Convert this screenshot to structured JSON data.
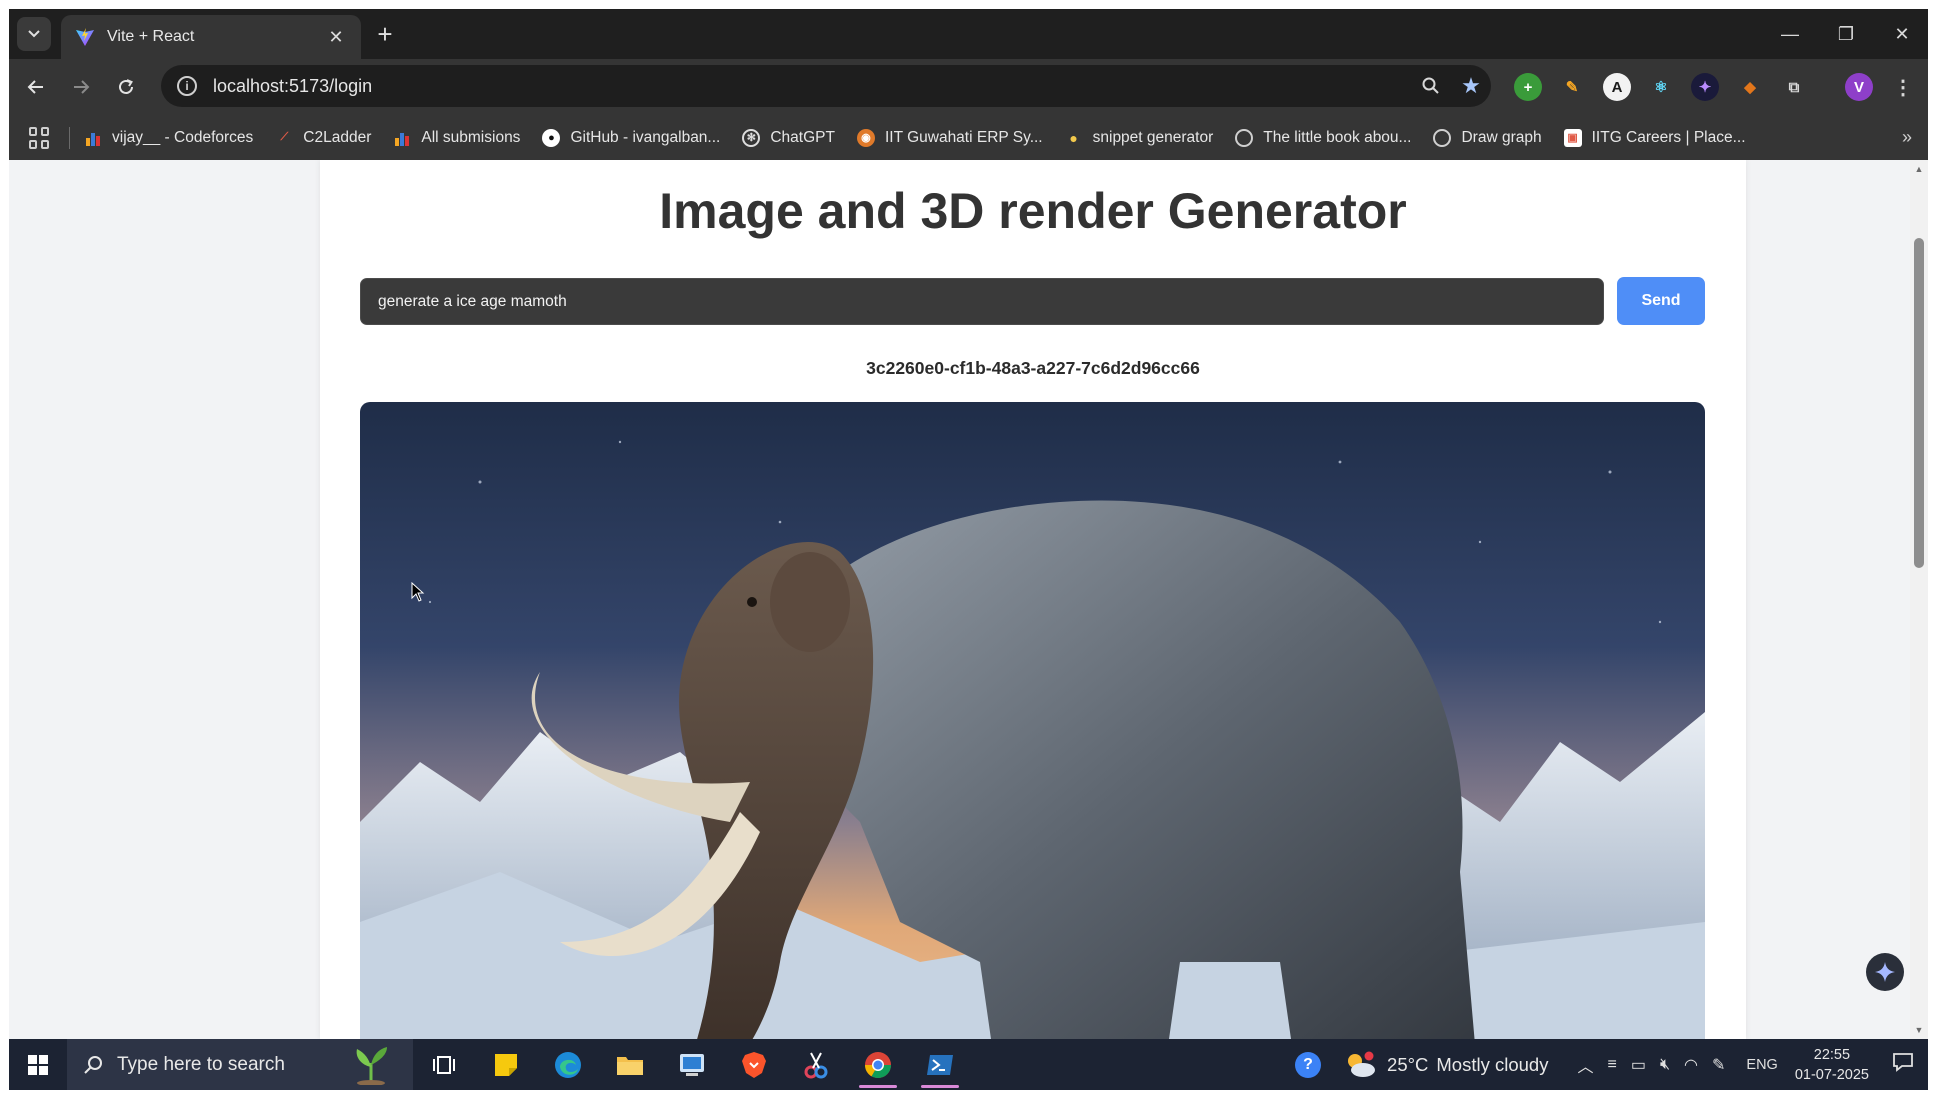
{
  "browser": {
    "tab_title": "Vite + React",
    "url": "localhost:5173/login",
    "bookmarks": [
      {
        "label": "vijay__ - Codeforces",
        "icon": "bar-chart-icon",
        "color": "#f5a623"
      },
      {
        "label": "C2Ladder",
        "icon": "ladder-icon",
        "color": "#e05a47"
      },
      {
        "label": "All submisions",
        "icon": "bar-chart-icon",
        "color": "#f5a623"
      },
      {
        "label": "GitHub - ivangalban...",
        "icon": "github-icon",
        "color": "#ffffff"
      },
      {
        "label": "ChatGPT",
        "icon": "chatgpt-icon",
        "color": "#ffffff"
      },
      {
        "label": "IIT Guwahati ERP Sy...",
        "icon": "iitg-icon",
        "color": "#e07a2a"
      },
      {
        "label": "snippet generator",
        "icon": "duck-icon",
        "color": "#f2c94c"
      },
      {
        "label": "The little book abou...",
        "icon": "globe-icon",
        "color": "#cfcfcf"
      },
      {
        "label": "Draw graph",
        "icon": "globe-icon",
        "color": "#cfcfcf"
      },
      {
        "label": "IITG Careers | Place...",
        "icon": "iitg-careers-icon",
        "color": "#e05a47"
      }
    ]
  },
  "page": {
    "title": "Image and 3D render Generator",
    "prompt_value": "generate a ice age mamoth",
    "send_label": "Send",
    "job_id": "3c2260e0-cf1b-48a3-a227-7c6d2d96cc66",
    "image_subject": "woolly mammoth in snowy mountains"
  },
  "taskbar": {
    "search_placeholder": "Type here to search",
    "temperature": "25°C",
    "weather": "Mostly cloudy",
    "language": "ENG",
    "time": "22:55",
    "date": "01-07-2025"
  },
  "colors": {
    "accent": "#4f8ef7",
    "chrome_dark": "#353535",
    "taskbar": "#1c2333"
  }
}
